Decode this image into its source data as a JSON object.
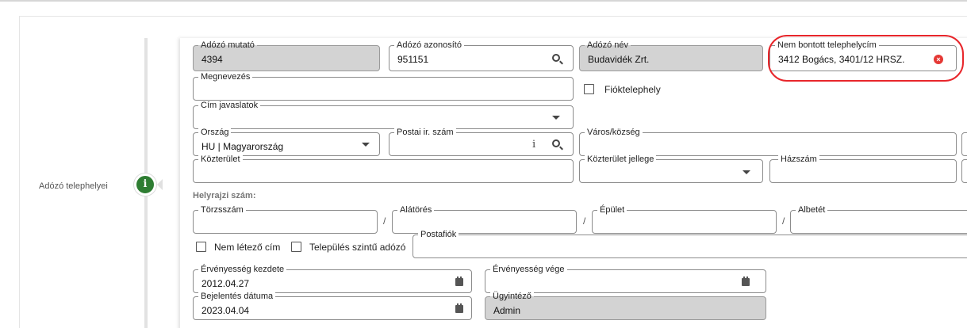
{
  "sidebar": {
    "label": "Adózó telephelyei",
    "info_glyph": "i"
  },
  "fields": {
    "adozo_mutato": {
      "label": "Adózó mutató",
      "value": "4394"
    },
    "adozo_azonosito": {
      "label": "Adózó azonosító",
      "value": "951151"
    },
    "adozo_nev": {
      "label": "Adózó név",
      "value": "Budavidék Zrt."
    },
    "nem_bontott": {
      "label": "Nem bontott telephelycím",
      "value": "3412 Bogács, 3401/12 HRSZ."
    },
    "megnevezes": {
      "label": "Megnevezés",
      "value": ""
    },
    "cim_javaslatok": {
      "label": "Cím javaslatok",
      "value": ""
    },
    "orszag": {
      "label": "Ország",
      "value": "HU | Magyarország"
    },
    "postai_ir_szam": {
      "label": "Postai ir. szám",
      "value": ""
    },
    "varos": {
      "label": "Város/község",
      "value": ""
    },
    "kozterulet": {
      "label": "Közterület",
      "value": ""
    },
    "kozterulet_jellege": {
      "label": "Közterület jellege",
      "value": ""
    },
    "hazszam": {
      "label": "Házszám",
      "value": ""
    },
    "torzsszam": {
      "label": "Törzsszám",
      "value": ""
    },
    "alatores": {
      "label": "Alátörés",
      "value": ""
    },
    "epulet": {
      "label": "Épület",
      "value": ""
    },
    "albetet": {
      "label": "Albetét",
      "value": ""
    },
    "postafiok": {
      "label": "Postafiók",
      "value": ""
    },
    "ervenyesseg_kezdete": {
      "label": "Érvényesség kezdete",
      "value": "2012.04.27"
    },
    "ervenyesseg_vege": {
      "label": "Érvényesség vége",
      "value": ""
    },
    "bejelentes_datuma": {
      "label": "Bejelentés dátuma",
      "value": "2023.04.04"
    },
    "ugyintezo": {
      "label": "Ügyintéző",
      "value": "Admin"
    }
  },
  "checkboxes": {
    "fioktelephely": {
      "label": "Fióktelephely",
      "checked": false
    },
    "nem_letezo_cim": {
      "label": "Nem létező cím",
      "checked": false
    },
    "telepules_szintu": {
      "label": "Település szintű adózó",
      "checked": false
    }
  },
  "sections": {
    "helyrajzi": "Helyrajzi szám:"
  },
  "separators": {
    "slash": "/"
  },
  "icons": {
    "search": "magnifier-icon",
    "info": "info-icon",
    "calendar": "calendar-icon",
    "clear": "clear-icon",
    "dropdown": "chevron-down-icon"
  },
  "colors": {
    "highlight": "#e8262b",
    "info_green": "#2e7d32",
    "readonly_bg": "#d3d3d3"
  }
}
